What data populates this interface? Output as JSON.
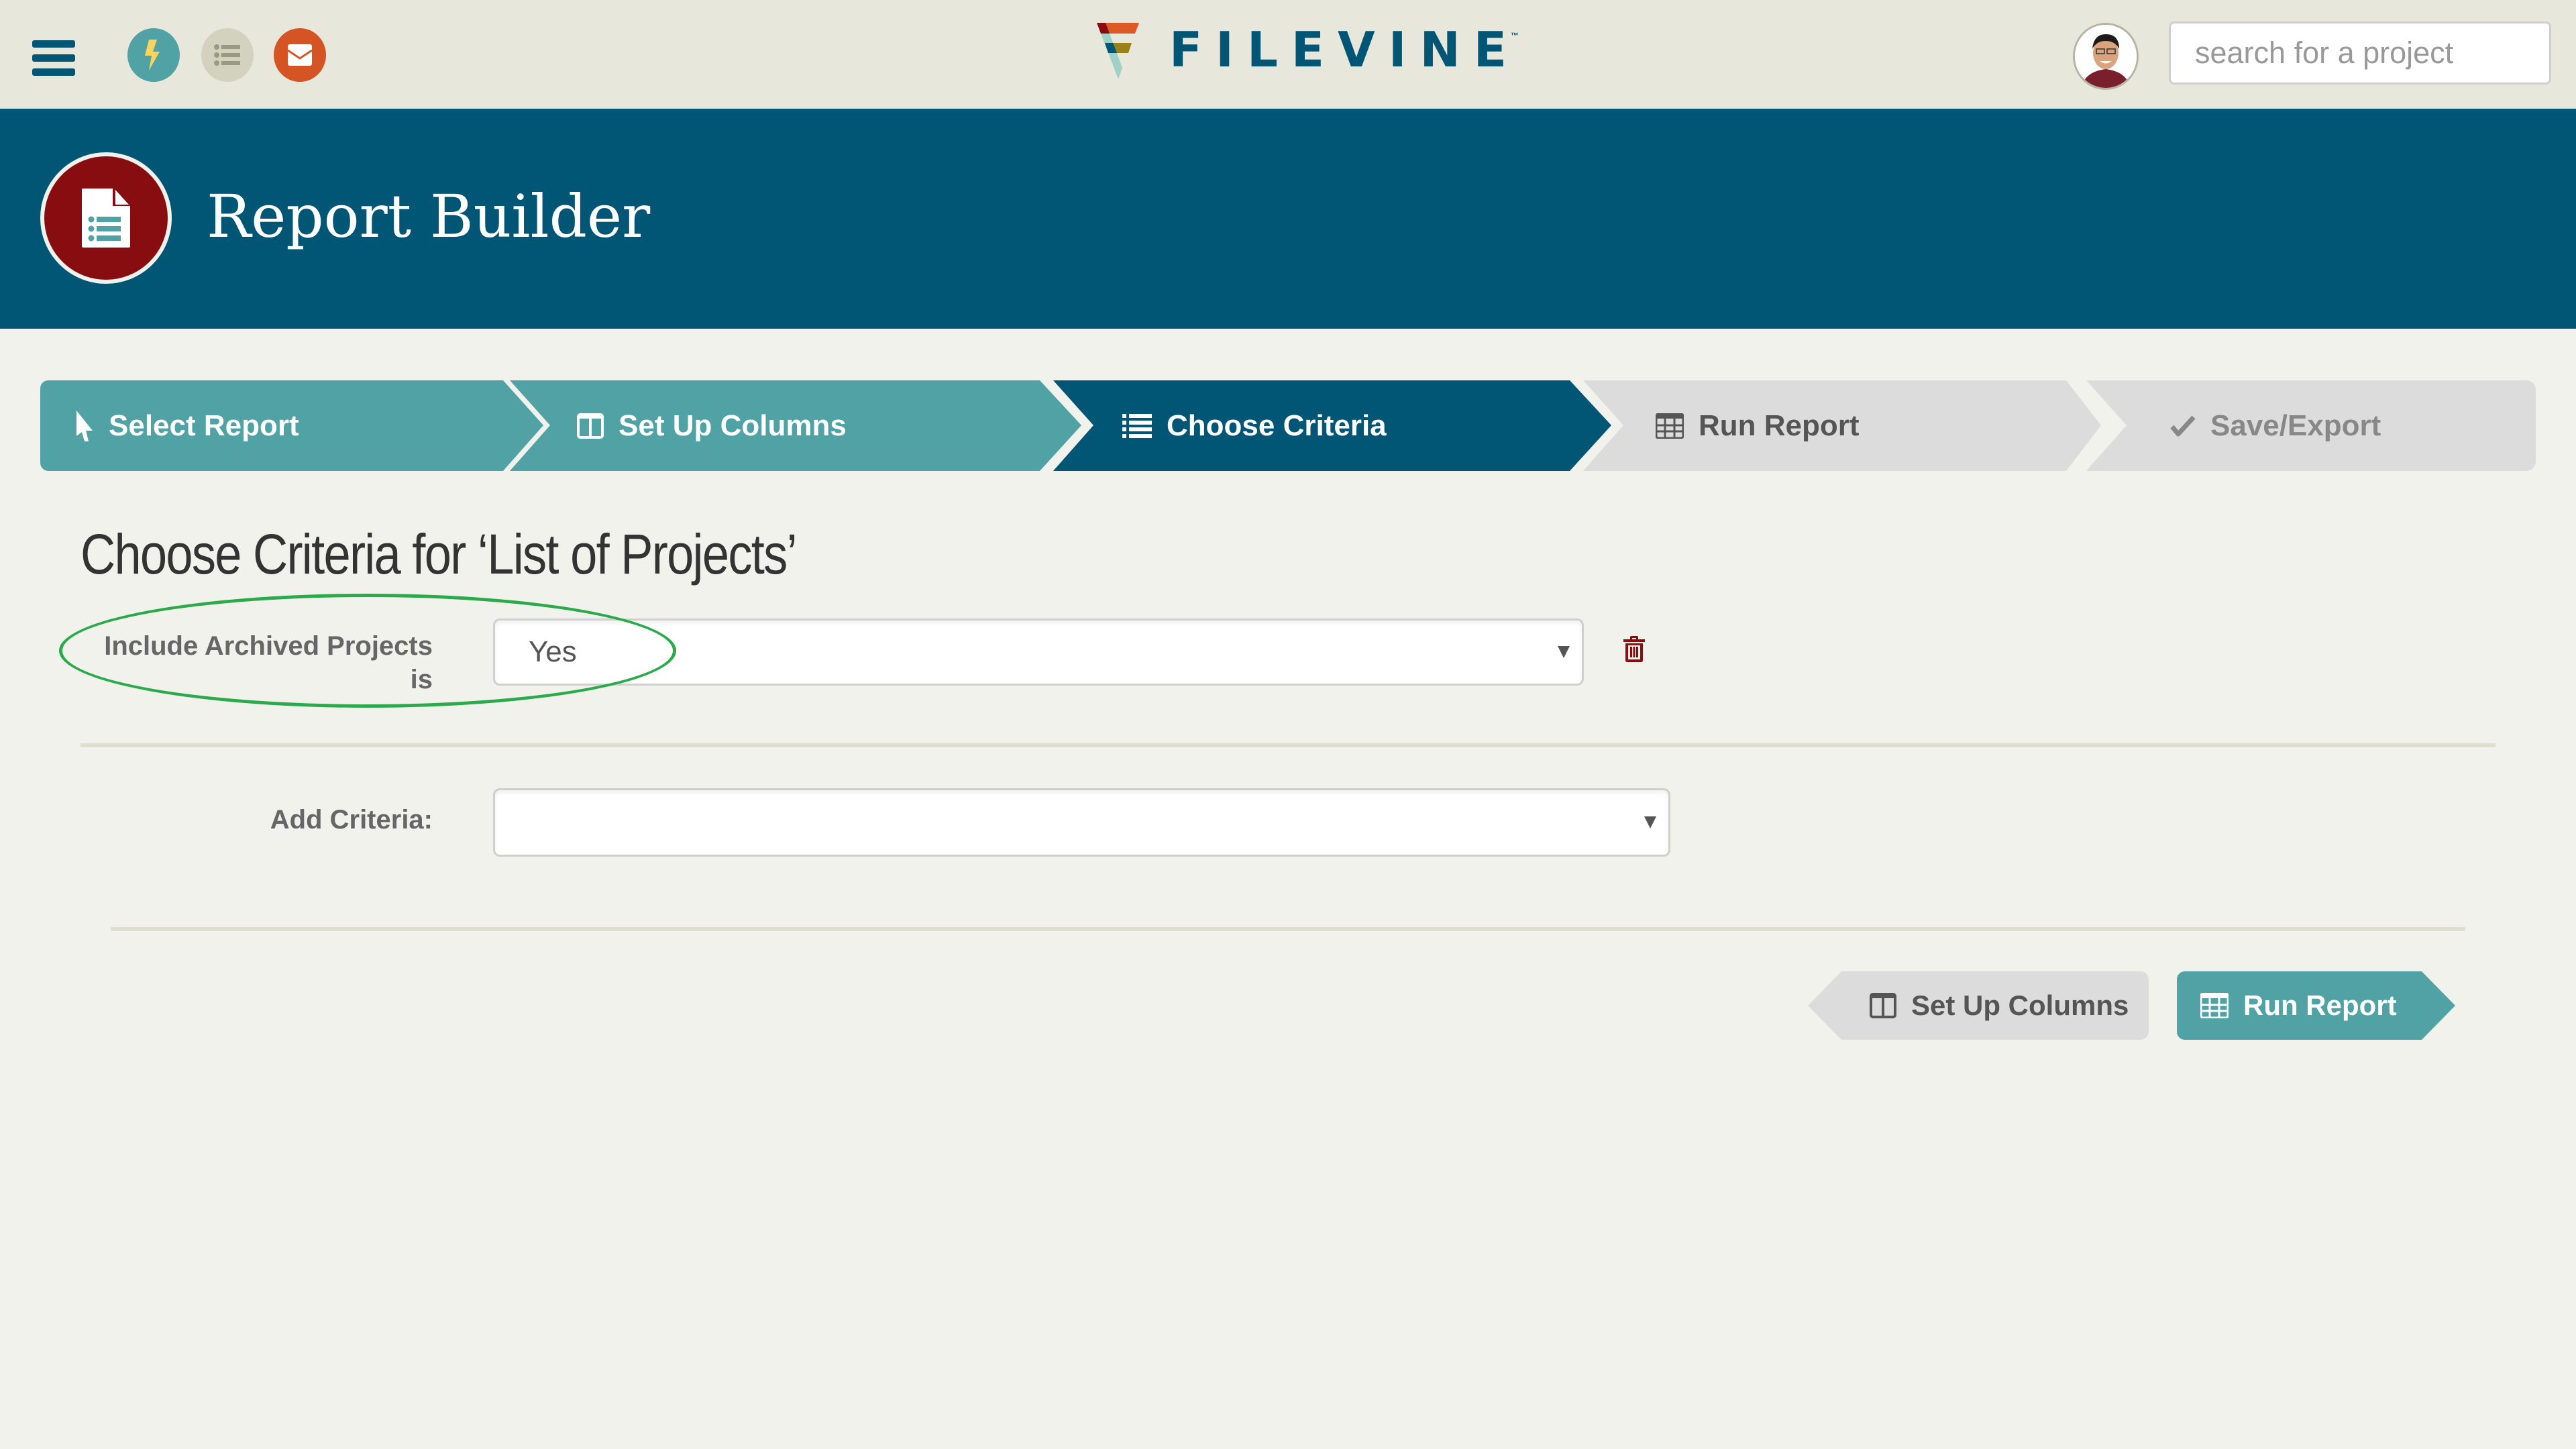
{
  "topbar": {
    "icons": {
      "menu": "hamburger-menu-icon",
      "activity": "lightning-bolt-icon",
      "tasks": "list-icon",
      "messages": "envelope-icon"
    },
    "logo_text": "FILEVINE",
    "logo_tm": "™",
    "avatar_alt": "User avatar",
    "search_placeholder": "search for a project",
    "search_value": ""
  },
  "header": {
    "title": "Report Builder",
    "icon": "report-document-icon"
  },
  "stepper": {
    "steps": [
      {
        "label": "Select Report",
        "icon": "cursor-pointer-icon",
        "state": "completed"
      },
      {
        "label": "Set Up Columns",
        "icon": "columns-icon",
        "state": "completed"
      },
      {
        "label": "Choose Criteria",
        "icon": "list-icon",
        "state": "active"
      },
      {
        "label": "Run Report",
        "icon": "table-icon",
        "state": "upcoming"
      },
      {
        "label": "Save/Export",
        "icon": "checkmark-icon",
        "state": "upcoming"
      }
    ]
  },
  "main": {
    "title": "Choose Criteria for ‘List of Projects’",
    "criteria": [
      {
        "label_line1": "Include Archived Projects",
        "label_line2": "is",
        "value": "Yes"
      }
    ],
    "add_criteria": {
      "label": "Add Criteria:",
      "value": ""
    },
    "buttons": {
      "back_label": "Set Up Columns",
      "next_label": "Run Report"
    }
  },
  "colors": {
    "brand_blue": "#025675",
    "teal": "#50a2a5",
    "topbar_bg": "#e8e7dc",
    "page_bg": "#f1f2ec",
    "header_icon_red": "#870d10",
    "mail_orange": "#d45423",
    "highlight_green": "#2aaa4a",
    "inactive_step": "#dcdcdc"
  }
}
